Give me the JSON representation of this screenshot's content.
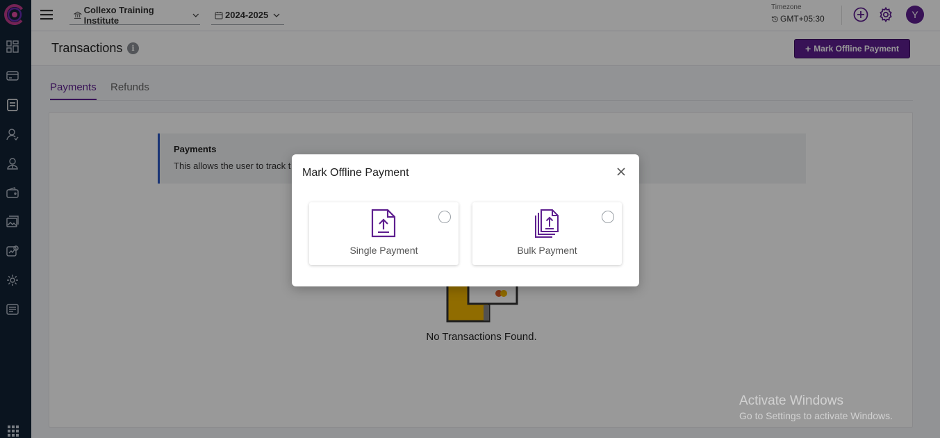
{
  "header": {
    "institute": "Collexo Training Institute",
    "academic_year": "2024-2025",
    "timezone_label": "Timezone",
    "timezone_value": "GMT+05:30",
    "avatar_initial": "Y"
  },
  "page": {
    "title": "Transactions",
    "info_glyph": "i",
    "primary_action_plus": "+",
    "primary_action": "Mark Offline Payment"
  },
  "tabs": [
    {
      "label": "Payments",
      "active": true
    },
    {
      "label": "Refunds",
      "active": false
    }
  ],
  "notice": {
    "title": "Payments",
    "text": "This allows the user to track t"
  },
  "empty_state": {
    "text": "No Transactions Found."
  },
  "modal": {
    "title": "Mark Offline Payment",
    "options": [
      {
        "label": "Single Payment",
        "selected": false,
        "icon": "file-upload-icon"
      },
      {
        "label": "Bulk Payment",
        "selected": false,
        "icon": "files-upload-icon"
      }
    ]
  },
  "watermark": {
    "line1": "Activate Windows",
    "line2": "Go to Settings to activate Windows."
  },
  "sidebar_icons": [
    "dashboard-icon",
    "card-icon",
    "document-icon",
    "user-icon",
    "user-tie-icon",
    "wallet-icon",
    "gallery-icon",
    "analytics-icon",
    "gear-icon",
    "news-icon"
  ],
  "colors": {
    "primary": "#5e1f8f",
    "sidebar": "#122234",
    "notice_border": "#2b58c4"
  }
}
